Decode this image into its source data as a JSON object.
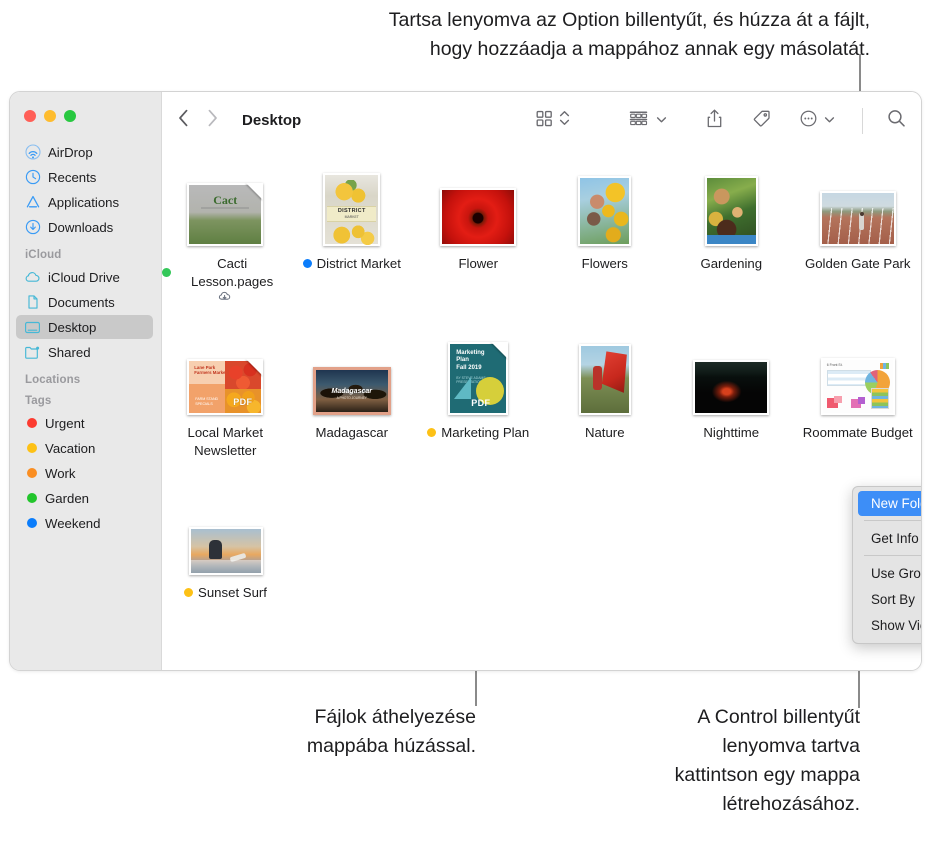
{
  "annotations": {
    "top": "Tartsa lenyomva az Option billentyűt, és húzza át a fájlt,\nhogy hozzáadja a mappához annak egy másolatát.",
    "middle": "Fájlok áthelyezése\nmappába húzással.",
    "right": "A Control billentyűt\nlenyomva tartva\nkattintson egy mappa\nlétrehozásához."
  },
  "window": {
    "traffic_lights": [
      {
        "name": "close",
        "color": "#FF5F57"
      },
      {
        "name": "minimize",
        "color": "#FEBC2E"
      },
      {
        "name": "zoom",
        "color": "#28C840"
      }
    ]
  },
  "toolbar": {
    "back_icon": "chevron-left-icon",
    "forward_icon": "chevron-right-icon",
    "title": "Desktop",
    "view_icon": "icon-view-grid-icon",
    "view_stepper_icon": "chevron-up-down-icon",
    "group_icon": "group-by-rows-icon",
    "group_chevron_icon": "chevron-down-icon",
    "share_icon": "share-icon",
    "tag_icon": "tag-icon",
    "more_icon": "ellipsis-circle-icon",
    "more_chevron_icon": "chevron-down-icon",
    "search_icon": "search-icon"
  },
  "sidebar": {
    "favorites": [
      {
        "label": "AirDrop",
        "icon": "airdrop-icon"
      },
      {
        "label": "Recents",
        "icon": "clock-icon"
      },
      {
        "label": "Applications",
        "icon": "applications-icon"
      },
      {
        "label": "Downloads",
        "icon": "download-icon"
      }
    ],
    "icloud_header": "iCloud",
    "icloud": [
      {
        "label": "iCloud Drive",
        "icon": "cloud-icon",
        "selected": false
      },
      {
        "label": "Documents",
        "icon": "document-icon",
        "selected": false
      },
      {
        "label": "Desktop",
        "icon": "desktop-icon",
        "selected": true
      },
      {
        "label": "Shared",
        "icon": "shared-folder-icon",
        "selected": false
      }
    ],
    "locations_header": "Locations",
    "tags_header": "Tags",
    "tags": [
      {
        "label": "Urgent",
        "color": "#FC3B30"
      },
      {
        "label": "Vacation",
        "color": "#FDC116"
      },
      {
        "label": "Work",
        "color": "#FA8E22"
      },
      {
        "label": "Garden",
        "color": "#22C52C"
      },
      {
        "label": "Weekend",
        "color": "#0B7DFB"
      }
    ]
  },
  "files": {
    "rows": [
      [
        {
          "name": "Cacti Lesson.pages",
          "kind": "pages-document",
          "tag": "#34C759",
          "cloud": true
        },
        {
          "name": "District Market",
          "kind": "image",
          "tag": "#0B7DFB",
          "cloud": false
        },
        {
          "name": "Flower",
          "kind": "image",
          "tag": null,
          "cloud": false
        },
        {
          "name": "Flowers",
          "kind": "image",
          "tag": null,
          "cloud": false
        },
        {
          "name": "Gardening",
          "kind": "image",
          "tag": null,
          "cloud": false
        },
        {
          "name": "Golden Gate Park",
          "kind": "image",
          "tag": null,
          "cloud": false
        }
      ],
      [
        {
          "name": "Local Market Newsletter",
          "kind": "pdf-document",
          "tag": null,
          "cloud": false
        },
        {
          "name": "Madagascar",
          "kind": "image",
          "tag": null,
          "cloud": false
        },
        {
          "name": "Marketing Plan",
          "kind": "pdf-document",
          "tag": "#FDC116",
          "cloud": false
        },
        {
          "name": "Nature",
          "kind": "image",
          "tag": null,
          "cloud": false
        },
        {
          "name": "Nighttime",
          "kind": "image",
          "tag": null,
          "cloud": false
        },
        {
          "name": "Roommate Budget",
          "kind": "numbers-document",
          "tag": null,
          "cloud": false
        }
      ],
      [
        {
          "name": "Sunset Surf",
          "kind": "image",
          "tag": "#FDC116",
          "cloud": false
        }
      ]
    ]
  },
  "context_menu": {
    "items": [
      {
        "label": "New Folder",
        "highlighted": true,
        "submenu": false,
        "separator_after": true
      },
      {
        "label": "Get Info",
        "highlighted": false,
        "submenu": false,
        "separator_after": true
      },
      {
        "label": "Use Groups",
        "highlighted": false,
        "submenu": false,
        "separator_after": false
      },
      {
        "label": "Sort By",
        "highlighted": false,
        "submenu": true,
        "separator_after": false
      },
      {
        "label": "Show View Options",
        "highlighted": false,
        "submenu": false,
        "separator_after": false
      }
    ],
    "submenu_arrow": "chevron-right-icon",
    "highlight_color": "#3d8ef7"
  }
}
